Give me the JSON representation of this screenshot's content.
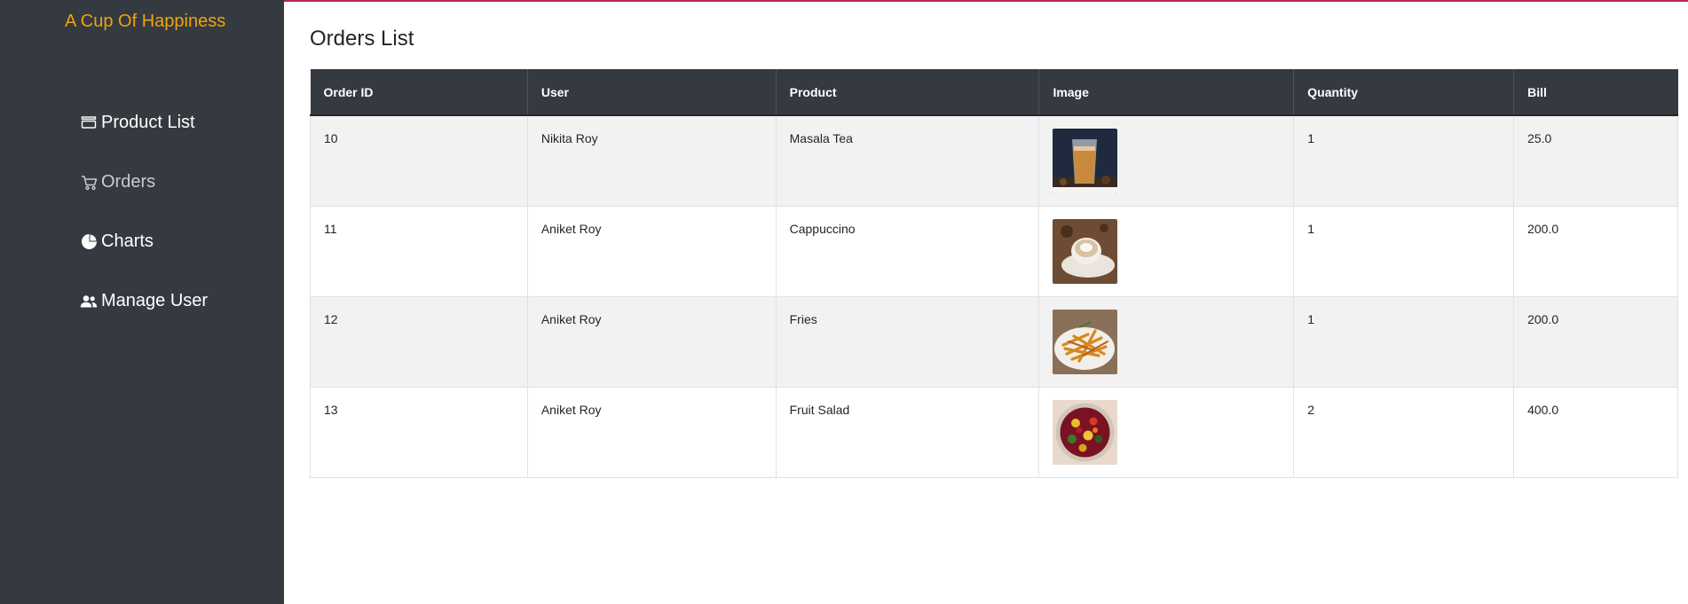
{
  "app": {
    "brand": "A Cup Of Happiness"
  },
  "sidebar": {
    "items": [
      {
        "label": "Product List",
        "icon": "product-list-icon"
      },
      {
        "label": "Orders",
        "icon": "cart-icon",
        "active": true
      },
      {
        "label": "Charts",
        "icon": "pie-chart-icon"
      },
      {
        "label": "Manage User",
        "icon": "users-icon"
      }
    ]
  },
  "main": {
    "title": "Orders List",
    "table": {
      "headers": [
        "Order ID",
        "User",
        "Product",
        "Image",
        "Quantity",
        "Bill"
      ],
      "rows": [
        {
          "order_id": "10",
          "user": "Nikita Roy",
          "product": "Masala Tea",
          "image": "masala-tea-image",
          "quantity": "1",
          "bill": "25.0"
        },
        {
          "order_id": "11",
          "user": "Aniket Roy",
          "product": "Cappuccino",
          "image": "cappuccino-image",
          "quantity": "1",
          "bill": "200.0"
        },
        {
          "order_id": "12",
          "user": "Aniket Roy",
          "product": "Fries",
          "image": "fries-image",
          "quantity": "1",
          "bill": "200.0"
        },
        {
          "order_id": "13",
          "user": "Aniket Roy",
          "product": "Fruit Salad",
          "image": "fruit-salad-image",
          "quantity": "2",
          "bill": "400.0"
        }
      ]
    }
  },
  "colors": {
    "sidebar_bg": "#343a40",
    "brand": "#f0a30a",
    "table_header_bg": "#343a40",
    "row_stripe": "#f2f2f2"
  }
}
